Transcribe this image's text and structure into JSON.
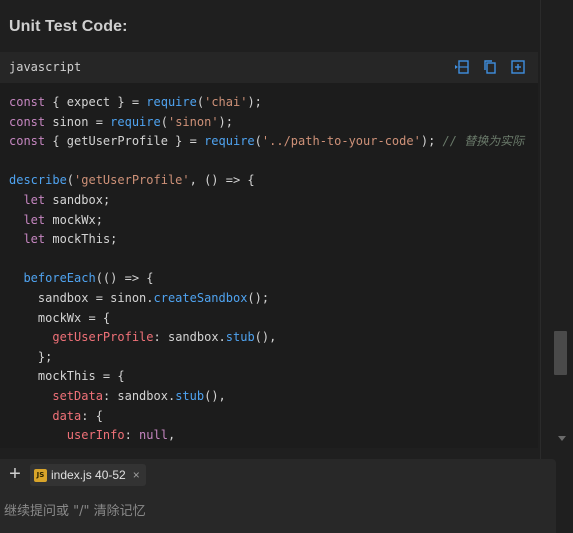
{
  "section": {
    "heading": "Unit Test Code:"
  },
  "code_block": {
    "language": "javascript",
    "icons": [
      "insert-at-cursor-icon",
      "copy-icon",
      "new-file-icon"
    ],
    "lines": [
      [
        [
          "kw",
          "const"
        ],
        [
          "plain",
          " { expect } = "
        ],
        [
          "fn",
          "require"
        ],
        [
          "plain",
          "("
        ],
        [
          "str",
          "'chai'"
        ],
        [
          "plain",
          ");"
        ]
      ],
      [
        [
          "kw",
          "const"
        ],
        [
          "plain",
          " sinon = "
        ],
        [
          "fn",
          "require"
        ],
        [
          "plain",
          "("
        ],
        [
          "str",
          "'sinon'"
        ],
        [
          "plain",
          ");"
        ]
      ],
      [
        [
          "kw",
          "const"
        ],
        [
          "plain",
          " { getUserProfile } = "
        ],
        [
          "fn",
          "require"
        ],
        [
          "plain",
          "("
        ],
        [
          "str",
          "'../path-to-your-code'"
        ],
        [
          "plain",
          "); "
        ],
        [
          "cmt",
          "// 替换为实际"
        ]
      ],
      [],
      [
        [
          "fn",
          "describe"
        ],
        [
          "plain",
          "("
        ],
        [
          "str",
          "'getUserProfile'"
        ],
        [
          "plain",
          ", () => {"
        ]
      ],
      [
        [
          "plain",
          "  "
        ],
        [
          "kw",
          "let"
        ],
        [
          "plain",
          " sandbox;"
        ]
      ],
      [
        [
          "plain",
          "  "
        ],
        [
          "kw",
          "let"
        ],
        [
          "plain",
          " mockWx;"
        ]
      ],
      [
        [
          "plain",
          "  "
        ],
        [
          "kw",
          "let"
        ],
        [
          "plain",
          " mockThis;"
        ]
      ],
      [],
      [
        [
          "plain",
          "  "
        ],
        [
          "fn",
          "beforeEach"
        ],
        [
          "plain",
          "(() => {"
        ]
      ],
      [
        [
          "plain",
          "    sandbox = sinon."
        ],
        [
          "fn",
          "createSandbox"
        ],
        [
          "plain",
          "();"
        ]
      ],
      [
        [
          "plain",
          "    mockWx = {"
        ]
      ],
      [
        [
          "plain",
          "      "
        ],
        [
          "prop",
          "getUserProfile"
        ],
        [
          "plain",
          ": sandbox."
        ],
        [
          "fn",
          "stub"
        ],
        [
          "plain",
          "(),"
        ]
      ],
      [
        [
          "plain",
          "    };"
        ]
      ],
      [
        [
          "plain",
          "    mockThis = {"
        ]
      ],
      [
        [
          "plain",
          "      "
        ],
        [
          "prop",
          "setData"
        ],
        [
          "plain",
          ": sandbox."
        ],
        [
          "fn",
          "stub"
        ],
        [
          "plain",
          "(),"
        ]
      ],
      [
        [
          "plain",
          "      "
        ],
        [
          "prop",
          "data"
        ],
        [
          "plain",
          ": {"
        ]
      ],
      [
        [
          "plain",
          "        "
        ],
        [
          "prop",
          "userInfo"
        ],
        [
          "plain",
          ": "
        ],
        [
          "kw",
          "null"
        ],
        [
          "plain",
          ","
        ]
      ]
    ]
  },
  "context": {
    "add_label": "+",
    "file_chip": {
      "badge": "JS",
      "label": "index.js 40-52",
      "close": "×"
    }
  },
  "input": {
    "placeholder": "继续提问或 \"/\" 清除记忆"
  }
}
